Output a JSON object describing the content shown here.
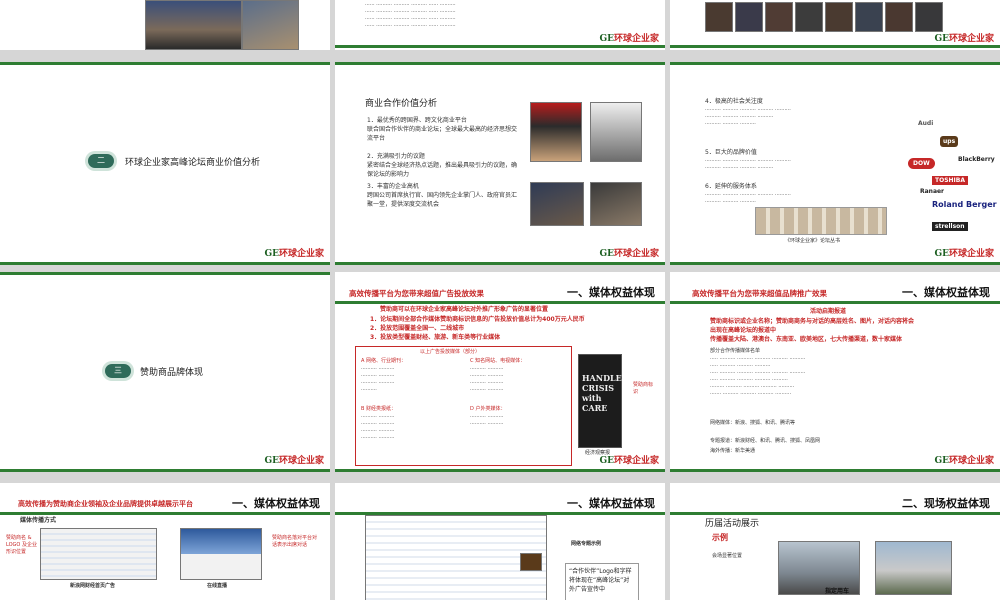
{
  "logo": {
    "prefix": "GE",
    "name": "环球企业家"
  },
  "slide_agenda_2": {
    "num": "二",
    "text": "环球企业家高峰论坛商业价值分析"
  },
  "slide_agenda_3": {
    "num": "三",
    "text": "赞助商品牌体现"
  },
  "slide_value": {
    "title": "商业合作价值分析",
    "p1_head": "1．最优秀的跨国界、跨文化商业平台",
    "p1_body": "联合国合作伙伴的商业论坛；全球最大最高的经济思想交流平台",
    "p2_head": "2．充满吸引力的议题",
    "p2_body": "紧密结合全球经济热点话题，推出最具吸引力的议题，确保论坛的影响力",
    "p3_head": "3．丰富的企业高机",
    "p3_body": "跨国公司首席执行官、国内领先企业掌门人、政府官员汇聚一堂，提供深度交流机会"
  },
  "slide_brand": {
    "i4": "4．极高的社会关注度",
    "i5": "5．巨大的品牌价值",
    "i6": "6．延伸的服务体系",
    "caption": "《环球企业家》论坛丛书",
    "brands": [
      "Audi",
      "ups",
      "BlackBerry",
      "DOW",
      "TOSHIBA",
      "Ranaer",
      "Roland Berger",
      "strellson"
    ]
  },
  "slide_media1": {
    "header": "高效传播平台为您带来超值广告投放效果",
    "section": "一、媒体权益体现",
    "r1": "赞助商可以在环球企业家高峰论坛对外推广形象广告的显著位置",
    "r2": "1．论坛期间全部合作媒体赞助商标识信息的广告投放价值总计为400万元人民币",
    "r3": "2．投放范围覆盖全国一、二线城市",
    "r4": "3．投放类型覆盖财经、旅游、新车类等行业媒体",
    "list_head": "以上广告投放媒体（部分）",
    "colA": "A 网络、行业期刊：",
    "colB": "B 财经类报纸：",
    "colC": "C 知名网站、电视媒体：",
    "colD": "D 户外类媒体：",
    "book_title": "HANDLE CRISIS with CARE",
    "book_caption": "经济观察报",
    "side_note": "赞助商标识"
  },
  "slide_media2": {
    "header": "高效传播平台为您带来超值品牌推广效果",
    "section": "一、媒体权益体现",
    "t1": "活动启期报道",
    "t2": "赞助商标识或企业名称；赞助商商务与对话的高层姓名、图片，对话内容将会",
    "t3": "出现在高峰论坛的报道中",
    "t4": "传播覆盖大陆、港澳台、东南亚、欧美地区，七大传播渠道，数十家媒体",
    "t5": "部分合作传播媒体名单",
    "t6": "网络媒体：新浪、搜狐、和讯、腾讯等",
    "t7": "专题报道：新浪财经、和讯、腾讯、搜狐、凤凰网",
    "t8": "海外传播：新华美通"
  },
  "slide_media3": {
    "header": "高效传播为赞助商企业领袖及企业品牌提供卓越展示平台",
    "section": "一、媒体权益体现",
    "sub": "媒体传播方式",
    "left_note": "赞助商名 & LOGO 及企业形识位置",
    "right_note": "赞助商名落对平台对话表示出席对话",
    "cap1": "新浪网财经首页广告",
    "cap2": "在线直播"
  },
  "slide_media4": {
    "section": "一、媒体权益体现",
    "tag": "网络专题示例",
    "quote": "“合作伙伴”Logo和字样将体现在“高峰论坛”对外广告宣传中"
  },
  "slide_site": {
    "section": "二、现场权益体现",
    "title": "历届活动展示",
    "example": "示例",
    "place": "会场显著位置",
    "car": "指定用车"
  }
}
